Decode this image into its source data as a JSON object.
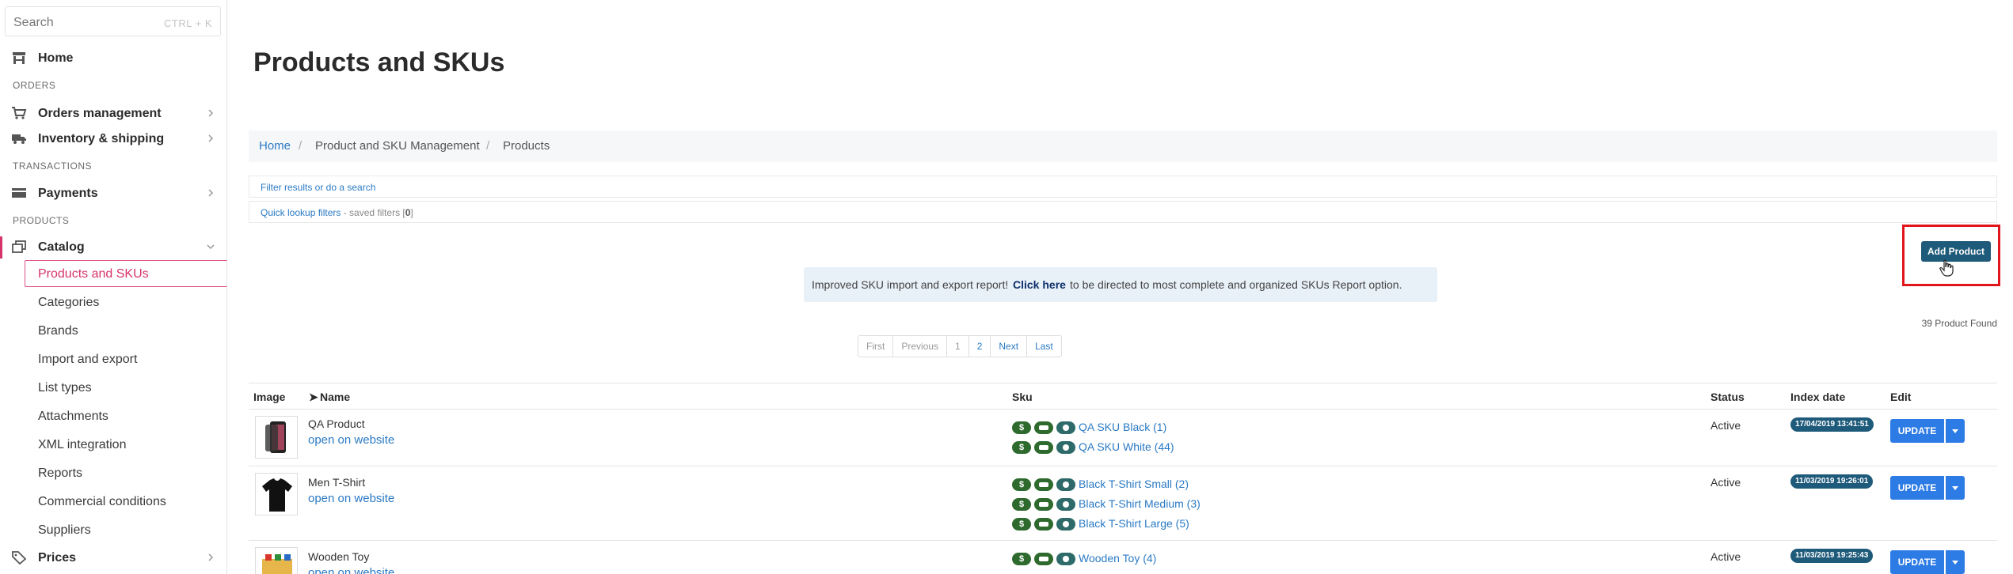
{
  "search": {
    "placeholder": "Search",
    "shortcut": "CTRL + K"
  },
  "nav": {
    "home": "Home",
    "orders_section": "ORDERS",
    "orders_management": "Orders management",
    "inventory": "Inventory & shipping",
    "transactions_section": "TRANSACTIONS",
    "payments": "Payments",
    "products_section": "PRODUCTS",
    "catalog": "Catalog",
    "catalog_items": [
      "Products and SKUs",
      "Categories",
      "Brands",
      "Import and export",
      "List types",
      "Attachments",
      "XML integration",
      "Reports",
      "Commercial conditions",
      "Suppliers"
    ],
    "prices": "Prices"
  },
  "page": {
    "title": "Products and SKUs"
  },
  "breadcrumb": {
    "home": "Home",
    "mgmt": "Product and SKU Management",
    "current": "Products",
    "sep": "/"
  },
  "filters": {
    "search_link": "Filter results or do a search",
    "quick_link": "Quick lookup filters",
    "saved_prefix": " - saved filters [",
    "saved_count": "0",
    "saved_suffix": "]"
  },
  "actions": {
    "add_product": "Add Product"
  },
  "notice": {
    "before": "Improved SKU import and export report!",
    "link": "Click here",
    "after": "to be directed to most complete and organized SKUs Report option."
  },
  "results": {
    "found": "39 Product Found"
  },
  "pager": [
    "First",
    "Previous",
    "1",
    "2",
    "Next",
    "Last"
  ],
  "table": {
    "headers": {
      "image": "Image",
      "name": "Name",
      "sku": "Sku",
      "status": "Status",
      "index_date": "Index date",
      "edit": "Edit"
    },
    "sort_glyph": "➤",
    "rows": [
      {
        "name": "QA Product",
        "link": "open on website",
        "skus": [
          "QA SKU Black (1)",
          "QA SKU White (44)"
        ],
        "status": "Active",
        "index_date": "17/04/2019 13:41:51",
        "update": "UPDATE"
      },
      {
        "name": "Men T-Shirt",
        "link": "open on website",
        "skus": [
          "Black T-Shirt Small (2)",
          "Black T-Shirt Medium (3)",
          "Black T-Shirt Large (5)"
        ],
        "status": "Active",
        "index_date": "11/03/2019 19:26:01",
        "update": "UPDATE"
      },
      {
        "name": "Wooden Toy",
        "link": "open on website",
        "skus": [
          "Wooden Toy (4)"
        ],
        "status": "Active",
        "index_date": "11/03/2019 19:25:43",
        "update": "UPDATE"
      }
    ]
  },
  "badges": {
    "price_glyph": "$"
  },
  "colors": {
    "accent_pink": "#d6336c",
    "link_blue": "#2b7ac4",
    "update_blue": "#2d7be5",
    "dark_teal": "#1e5a7a",
    "badge_green": "#2e6a2e",
    "highlight_red": "#e0161b"
  }
}
